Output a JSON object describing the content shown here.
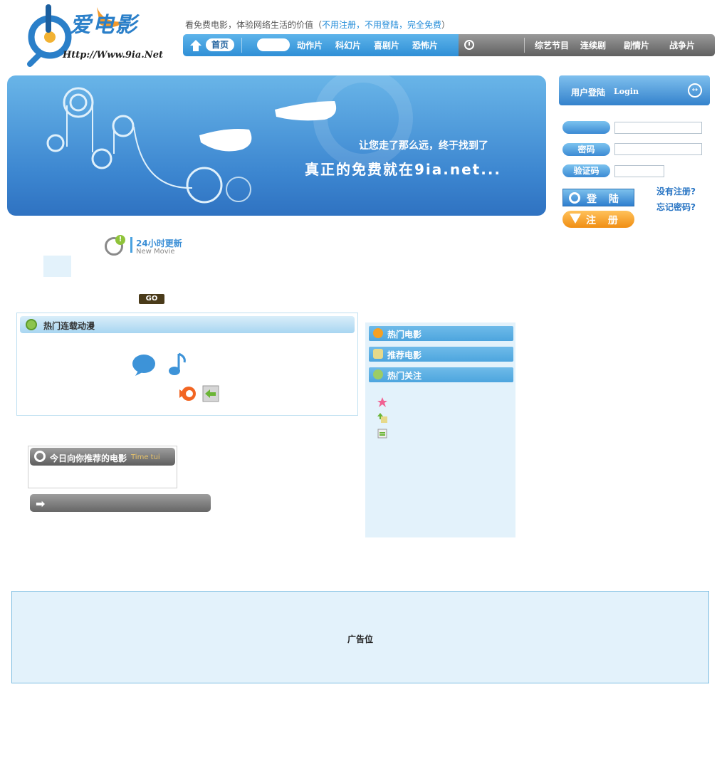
{
  "logo": {
    "text": "爱电影",
    "url": "Http://Www.9ia.Net"
  },
  "tagline": {
    "prefix": "看免费电影，体验网络生活的价值（",
    "highlight": "不用注册，不用登陆，完全免费",
    "suffix": "）"
  },
  "nav": {
    "home": "首页",
    "left_items": [
      "动作片",
      "科幻片",
      "喜剧片",
      "恐怖片"
    ],
    "right_items": [
      "综艺节目",
      "连续剧",
      "剧情片",
      "战争片"
    ]
  },
  "banner": {
    "line1": "让您走了那么远，终于找到了",
    "line2": "真正的免费就在9ia.net..."
  },
  "login": {
    "title": "用户登陆",
    "title_en": "Login",
    "username_label": "",
    "password_label": "密码",
    "captcha_label": "验证码",
    "login_button": "登 陆",
    "register_button": "注 册",
    "no_account_link": "没有注册?",
    "forgot_link": "忘记密码?"
  },
  "update": {
    "title": "24小时更新",
    "subtitle": "New Movie",
    "go": "GO"
  },
  "anime": {
    "title": "热门连载动漫"
  },
  "today": {
    "title": "今日向你推荐的电影",
    "subtitle": "Time tui"
  },
  "hot": {
    "tabs": [
      "热门电影",
      "推荐电影",
      "热门关注"
    ]
  },
  "ad": {
    "label": "广告位"
  },
  "colors": {
    "nav_blue": "#3c9ae0",
    "nav_gray": "#6f6f6f",
    "banner_blue": "#3c86d0",
    "ad_bg": "#e3f2fb",
    "register_orange": "#f5a023"
  }
}
